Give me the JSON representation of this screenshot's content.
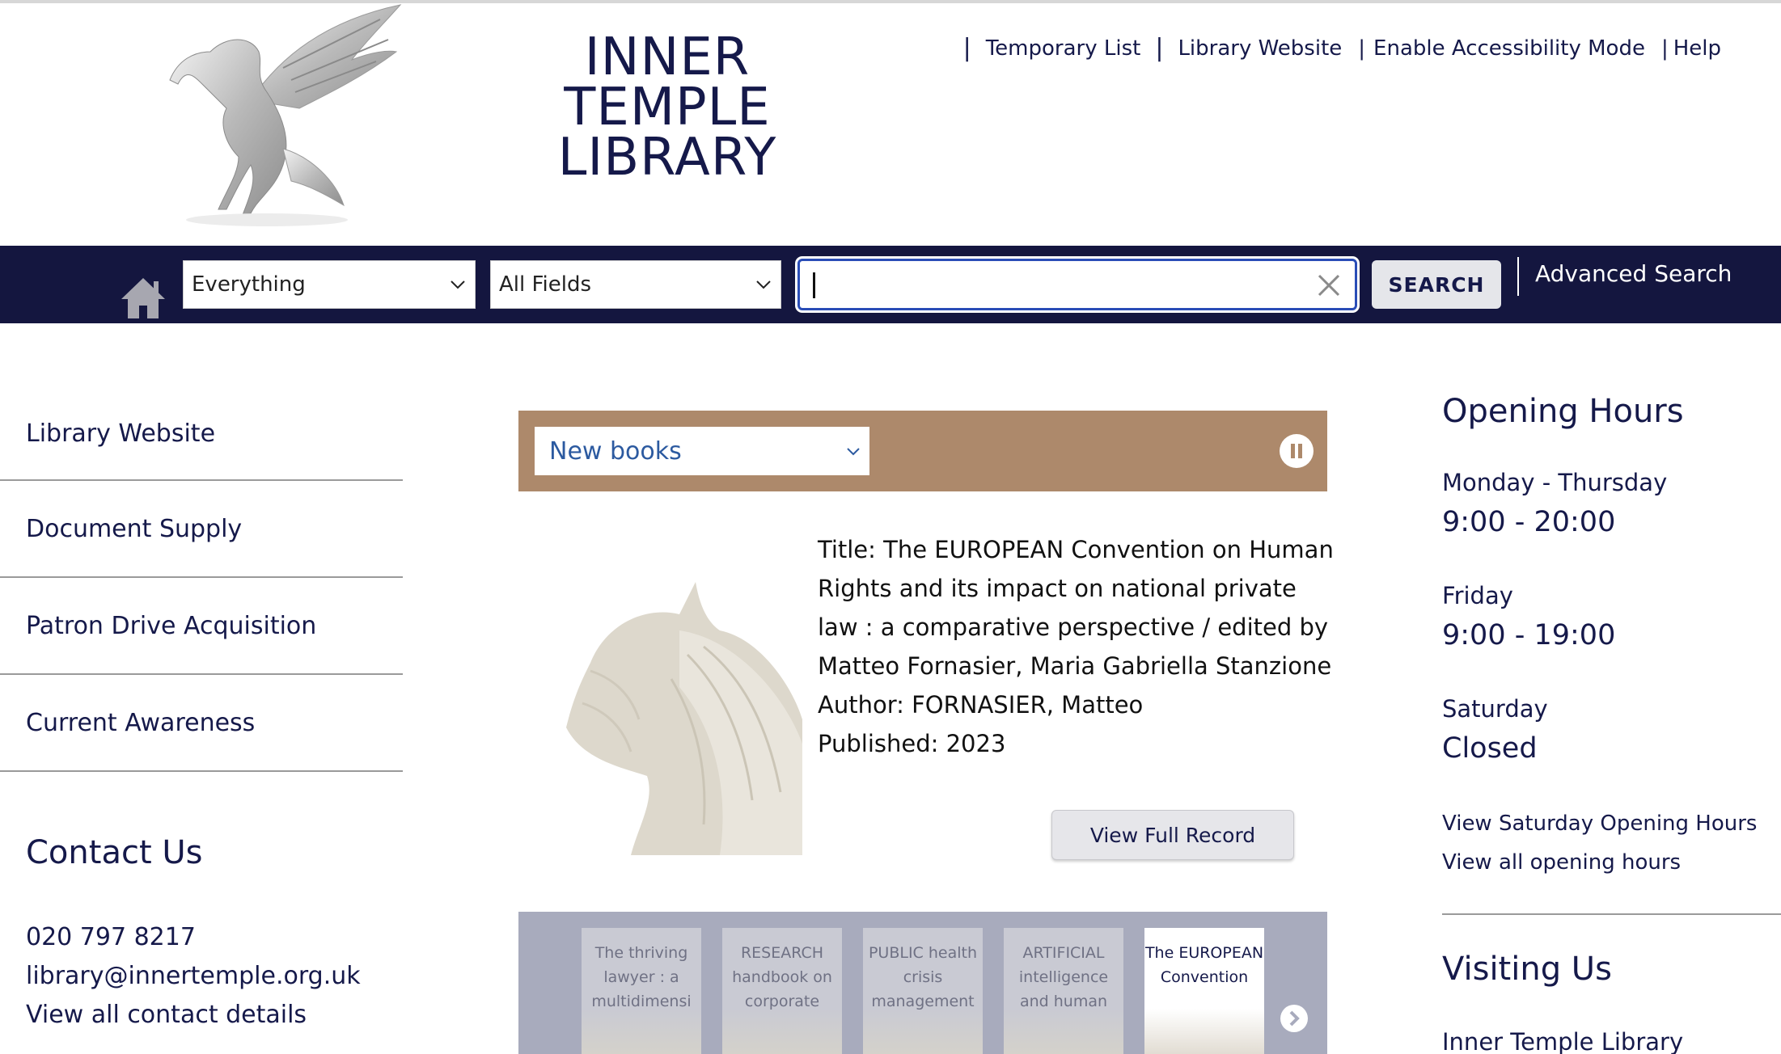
{
  "header": {
    "logo_text": [
      "INNER",
      "TEMPLE",
      "LIBRARY"
    ],
    "links": [
      "Temporary List",
      "Library Website",
      "Enable Accessibility Mode",
      "Help"
    ]
  },
  "navbar": {
    "scope_select": "Everything",
    "field_select": "All Fields",
    "search_value": "",
    "search_button": "SEARCH",
    "advanced_search": "Advanced Search"
  },
  "sidebar": {
    "items": [
      "Library Website",
      "Document Supply",
      "Patron Drive Acquisition",
      "Current Awareness"
    ],
    "contact_heading": "Contact Us",
    "phone": "020 797 8217",
    "email": "library@innertemple.org.uk",
    "contact_link": "View all contact details"
  },
  "carousel": {
    "select_value": "New books",
    "book": {
      "title_line": "Title: The EUROPEAN Convention on Human Rights and its impact on national private law : a comparative perspective / edited by Matteo Fornasier, Maria Gabriella Stanzione",
      "author_line": "Author: FORNASIER, Matteo",
      "published_line": "Published: 2023"
    },
    "view_button": "View Full Record",
    "thumbnails": [
      {
        "text": "The thriving lawyer : a multidimensi",
        "active": false
      },
      {
        "text": "RESEARCH handbook on corporate",
        "active": false
      },
      {
        "text": "PUBLIC health crisis management",
        "active": false
      },
      {
        "text": "ARTIFICIAL intelligence and human",
        "active": false
      },
      {
        "text": "The EUROPEAN Convention",
        "active": true
      }
    ]
  },
  "opening_hours": {
    "heading": "Opening Hours",
    "schedule": [
      {
        "day": "Monday - Thursday",
        "time": "9:00 - 20:00"
      },
      {
        "day": "Friday",
        "time": "9:00 - 19:00"
      },
      {
        "day": "Saturday",
        "time": "Closed"
      }
    ],
    "link_saturday": "View Saturday Opening Hours",
    "link_all": "View all opening hours",
    "visiting_heading": "Visiting Us",
    "visiting_line": "Inner Temple Library"
  },
  "colors": {
    "navy": "#14163f",
    "carousel_brown": "#ad896b",
    "thumb_strip": "#a8abbd",
    "search_border": "#2a4db7"
  }
}
